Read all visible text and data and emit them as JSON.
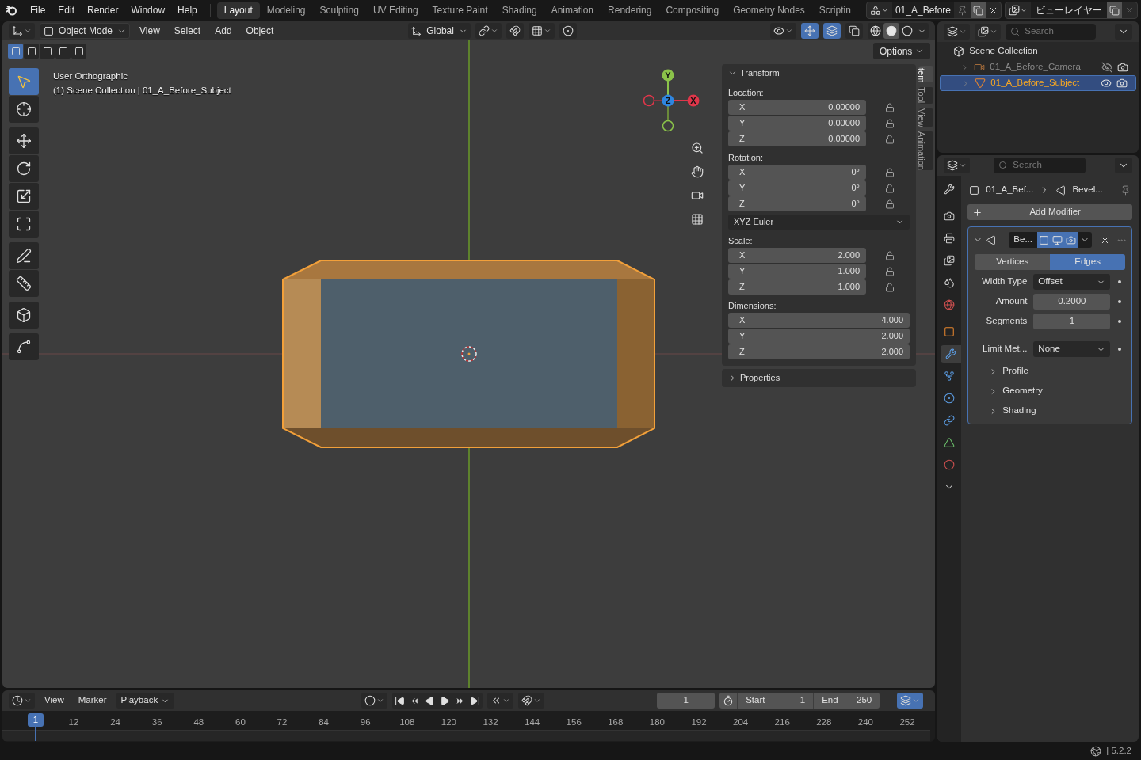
{
  "menu": [
    "File",
    "Edit",
    "Render",
    "Window",
    "Help"
  ],
  "workspaces": [
    {
      "label": "Layout",
      "selected": true
    },
    {
      "label": "Modeling",
      "selected": false
    },
    {
      "label": "Sculpting",
      "selected": false
    },
    {
      "label": "UV Editing",
      "selected": false
    },
    {
      "label": "Texture Paint",
      "selected": false
    },
    {
      "label": "Shading",
      "selected": false
    },
    {
      "label": "Animation",
      "selected": false
    },
    {
      "label": "Rendering",
      "selected": false
    },
    {
      "label": "Compositing",
      "selected": false
    },
    {
      "label": "Geometry Nodes",
      "selected": false
    },
    {
      "label": "Scriptin",
      "selected": false
    }
  ],
  "scene": "01_A_Before",
  "view_layer": "ビューレイヤー",
  "viewport_header": {
    "mode": "Object Mode",
    "menus": [
      "View",
      "Select",
      "Add",
      "Object"
    ],
    "orientation": "Global",
    "options": "Options"
  },
  "overlay_text": [
    "User Orthographic",
    "(1) Scene Collection | 01_A_Before_Subject"
  ],
  "gizmo_axes": [
    {
      "label": "Y",
      "color": "#8bc34a"
    },
    {
      "label": "Z",
      "color": "#2f86e0"
    },
    {
      "label": "X",
      "color": "#e0364a"
    }
  ],
  "tool_groups": [
    {
      "tools": [
        {
          "kind": "select",
          "selected": true
        },
        {
          "kind": "cursor",
          "selected": false
        }
      ]
    },
    {
      "tools": [
        {
          "kind": "move",
          "selected": false
        },
        {
          "kind": "rotate",
          "selected": false
        },
        {
          "kind": "scale",
          "selected": false
        },
        {
          "kind": "transform",
          "selected": false
        }
      ]
    },
    {
      "tools": [
        {
          "kind": "annotate",
          "selected": false
        },
        {
          "kind": "measure",
          "selected": false
        }
      ]
    },
    {
      "tools": [
        {
          "kind": "add_cube",
          "selected": false
        }
      ]
    },
    {
      "tools": [
        {
          "kind": "curve",
          "selected": false
        }
      ]
    }
  ],
  "n_panel": {
    "tabs": [
      {
        "label": "Item",
        "selected": true
      },
      {
        "label": "Tool",
        "selected": false
      },
      {
        "label": "View",
        "selected": false
      },
      {
        "label": "Animation",
        "selected": false
      }
    ],
    "transform": {
      "title": "Transform",
      "expanded": true,
      "sections": [
        {
          "kind": "vector_lock",
          "label": "Location:",
          "rows": [
            {
              "axis": "X",
              "value": "0.00000"
            },
            {
              "axis": "Y",
              "value": "0.00000"
            },
            {
              "axis": "Z",
              "value": "0.00000"
            }
          ]
        },
        {
          "kind": "vector_lock",
          "label": "Rotation:",
          "rows": [
            {
              "axis": "X",
              "value": "0°"
            },
            {
              "axis": "Y",
              "value": "0°"
            },
            {
              "axis": "Z",
              "value": "0°"
            }
          ]
        },
        {
          "kind": "dropdown",
          "value": "XYZ Euler"
        },
        {
          "kind": "vector_lock",
          "label": "Scale:",
          "rows": [
            {
              "axis": "X",
              "value": "2.000"
            },
            {
              "axis": "Y",
              "value": "1.000"
            },
            {
              "axis": "Z",
              "value": "1.000"
            }
          ]
        },
        {
          "kind": "vector",
          "label": "Dimensions:",
          "rows": [
            {
              "axis": "X",
              "value": "4.000"
            },
            {
              "axis": "Y",
              "value": "2.000"
            },
            {
              "axis": "Z",
              "value": "2.000"
            }
          ]
        }
      ]
    },
    "properties": {
      "title": "Properties",
      "expanded": false
    }
  },
  "outliner": {
    "search_placeholder": "Search",
    "root": "Scene Collection",
    "items": [
      {
        "kind": "camera",
        "name": "01_A_Before_Camera",
        "selected": false,
        "visible": false
      },
      {
        "kind": "mesh",
        "name": "01_A_Before_Subject",
        "selected": true,
        "visible": true
      }
    ]
  },
  "properties": {
    "search_placeholder": "Search",
    "tabs": [
      {
        "kind": "tool",
        "selected": false
      },
      {
        "kind": "render",
        "selected": false
      },
      {
        "kind": "output",
        "selected": false
      },
      {
        "kind": "view_layer",
        "selected": false
      },
      {
        "kind": "scene",
        "selected": false
      },
      {
        "kind": "world",
        "selected": false
      },
      {
        "kind": "object",
        "selected": false
      },
      {
        "kind": "modifiers",
        "selected": true
      },
      {
        "kind": "particles",
        "selected": false
      },
      {
        "kind": "physics",
        "selected": false
      },
      {
        "kind": "constraints",
        "selected": false
      },
      {
        "kind": "data",
        "selected": false
      },
      {
        "kind": "material",
        "selected": false
      },
      {
        "kind": "more",
        "selected": false
      }
    ],
    "breadcrumb": [
      "01_A_Bef...",
      "Bevel..."
    ],
    "add_modifier": "Add Modifier",
    "modifier": {
      "name": "Be...",
      "expanded": true,
      "affect": [
        {
          "label": "Vertices",
          "selected": false
        },
        {
          "label": "Edges",
          "selected": true
        }
      ],
      "fields": [
        {
          "kind": "dropdown",
          "label": "Width Type",
          "value": "Offset"
        },
        {
          "kind": "number",
          "label": "Amount",
          "value": "0.2000"
        },
        {
          "kind": "number",
          "label": "Segments",
          "value": "1"
        },
        {
          "kind": "dropdown",
          "label": "Limit Met...",
          "value": "None"
        }
      ],
      "subpanels": [
        {
          "label": "Profile",
          "expanded": false
        },
        {
          "label": "Geometry",
          "expanded": false
        },
        {
          "label": "Shading",
          "expanded": false
        }
      ]
    }
  },
  "timeline": {
    "menus": [
      "View",
      "Marker"
    ],
    "playback": "Playback",
    "current_frame": "1",
    "start_label": "Start",
    "start": "1",
    "end_label": "End",
    "end": "250",
    "playhead": "1",
    "ticks": [
      "12",
      "24",
      "36",
      "48",
      "60",
      "72",
      "84",
      "96",
      "108",
      "120",
      "132",
      "144",
      "156",
      "168",
      "180",
      "192",
      "204",
      "216",
      "228",
      "240",
      "252"
    ]
  },
  "status": {
    "version": "| 5.2.2"
  }
}
